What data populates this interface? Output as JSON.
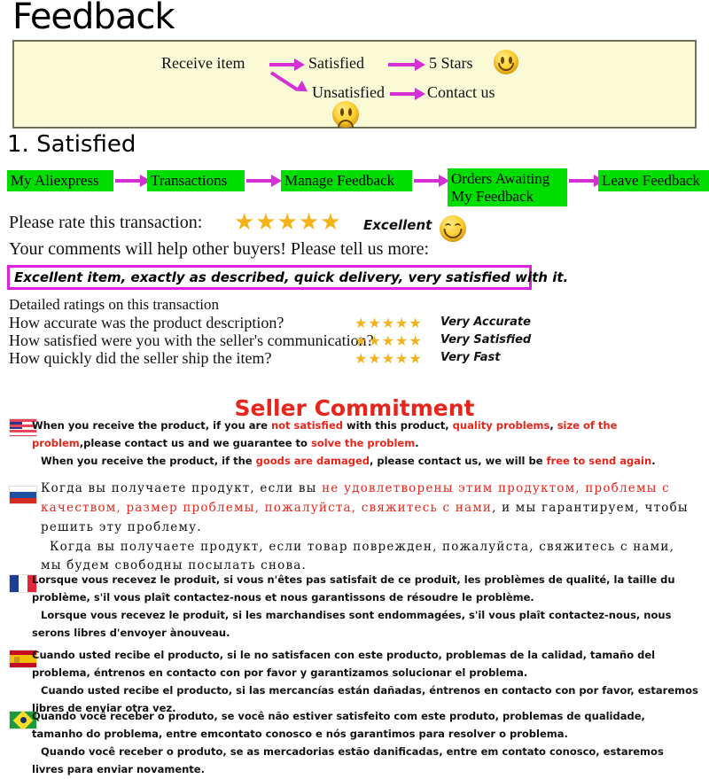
{
  "page": {
    "title": "Feedback"
  },
  "flow": {
    "receive": "Receive item",
    "satisfied": "Satisfied",
    "five_stars": "5 Stars",
    "unsatisfied": "Unsatisfied",
    "contact": "Contact us",
    "happy_face_icon": "smiling-face-icon",
    "sad_face_icon": "frowning-face-icon",
    "arrow_color": "#D430D4",
    "box_bg": "#FAFAD7",
    "box_border": "#6E6E5A"
  },
  "section1": {
    "heading": "1. Satisfied",
    "step_color": "#00DD00",
    "steps": [
      {
        "label": "My Aliexpress"
      },
      {
        "label": "Transactions"
      },
      {
        "label": "Manage Feedback"
      },
      {
        "label": "Orders Awaiting\nMy Feedback"
      },
      {
        "label": "Leave Feedback"
      }
    ],
    "rate_prompt": "Please rate this transaction:",
    "rate_stars": "★★★★★",
    "rate_word": "Excellent",
    "comments_prompt": "Your comments will help other buyers! Please tell us more:",
    "comment_value": "Excellent item, exactly as described, quick delivery, very satisfied with it.",
    "comment_border_color": "#E020E0",
    "detailed_heading": "Detailed ratings on this transaction",
    "detailed": [
      {
        "question": "How accurate was the product description?",
        "stars": "★★★★★",
        "label": "Very Accurate"
      },
      {
        "question": "How satisfied were you with the seller's communication?",
        "stars": "★★★★★",
        "label": "Very Satisfied"
      },
      {
        "question": "How quickly did the seller ship the item?",
        "stars": "★★★★★",
        "label": "Very Fast"
      }
    ]
  },
  "commitment": {
    "title": "Seller Commitment",
    "title_color": "#E8251B",
    "highlight_color": "#E8251B",
    "languages": [
      {
        "flag_icon": "flag-usa-icon",
        "lines": [
          [
            {
              "t": "When you receive the product, if you are ",
              "hl": false
            },
            {
              "t": "not satisfied",
              "hl": true
            },
            {
              "t": " with this product, ",
              "hl": false
            },
            {
              "t": "quality problems",
              "hl": true
            },
            {
              "t": ", ",
              "hl": false
            },
            {
              "t": "size of the problem",
              "hl": true
            },
            {
              "t": ",please contact us and we guarantee to ",
              "hl": false
            },
            {
              "t": "solve the problem",
              "hl": true
            },
            {
              "t": ".",
              "hl": false
            }
          ],
          [
            {
              "t": "When you receive the product, if the ",
              "hl": false
            },
            {
              "t": "goods are damaged",
              "hl": true
            },
            {
              "t": ", please contact us, we will be ",
              "hl": false
            },
            {
              "t": "free to send again",
              "hl": true
            },
            {
              "t": ".",
              "hl": false
            }
          ]
        ]
      },
      {
        "flag_icon": "flag-russia-icon",
        "lines": [
          [
            {
              "t": "Когда вы получаете продукт, если вы ",
              "hl": false
            },
            {
              "t": "не удовлетворены этим продуктом, проблемы с качеством, размер проблемы, пожалуйста, свяжитесь с нами",
              "hl": true
            },
            {
              "t": ", и мы гарантируем, чтобы решить эту проблему.",
              "hl": false
            }
          ],
          [
            {
              "t": "Когда вы получаете продукт, если товар поврежден, пожалуйста, свяжитесь с нами, мы будем свободны посылать снова.",
              "hl": false
            }
          ]
        ]
      },
      {
        "flag_icon": "flag-france-icon",
        "lines": [
          [
            {
              "t": "Lorsque vous recevez le produit, si vous n'êtes pas satisfait de ce produit, les problèmes de qualité, la taille du problème, s'il vous plaît contactez-nous et nous garantissons de résoudre le problème.",
              "hl": false
            }
          ],
          [
            {
              "t": "Lorsque vous recevez le produit, si les marchandises sont endommagées, s'il vous plaît contactez-nous, nous serons libres d'envoyer ànouveau.",
              "hl": false
            }
          ]
        ]
      },
      {
        "flag_icon": "flag-spain-icon",
        "lines": [
          [
            {
              "t": "Cuando usted recibe el producto, si le no satisfacen con este producto, problemas de la calidad, tamaño del problema, éntrenos en contacto con por favor y garantizamos solucionar el problema.",
              "hl": false
            }
          ],
          [
            {
              "t": "Cuando usted recibe el producto, si las mercancías están dañadas, éntrenos en contacto con por favor, estaremos libres de enviar otra vez.",
              "hl": false
            }
          ]
        ]
      },
      {
        "flag_icon": "flag-brazil-icon",
        "lines": [
          [
            {
              "t": "Quando você receber o produto, se você não estiver satisfeito com este produto, problemas de qualidade, tamanho do problema, entre emcontato conosco e nós garantimos para resolver o problema.",
              "hl": false
            }
          ],
          [
            {
              "t": "Quando você receber o produto, se as mercadorias estão danificadas, entre em contato conosco, estaremos livres para enviar novamente.",
              "hl": false
            }
          ]
        ]
      }
    ]
  }
}
